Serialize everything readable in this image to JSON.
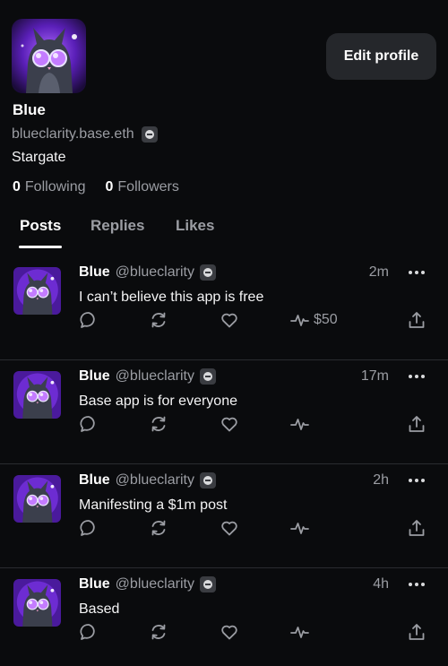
{
  "profile": {
    "display_name": "Blue",
    "handle": "blueclarity.base.eth",
    "bio": "Stargate",
    "following_count": "0",
    "following_label": "Following",
    "followers_count": "0",
    "followers_label": "Followers",
    "edit_label": "Edit profile"
  },
  "tabs": [
    {
      "label": "Posts",
      "active": true
    },
    {
      "label": "Replies",
      "active": false
    },
    {
      "label": "Likes",
      "active": false
    }
  ],
  "posts": [
    {
      "name": "Blue",
      "handle": "@blueclarity",
      "time": "2m",
      "text": "I can’t believe this app is free",
      "tip": "$50"
    },
    {
      "name": "Blue",
      "handle": "@blueclarity",
      "time": "17m",
      "text": "Base app is for everyone",
      "tip": ""
    },
    {
      "name": "Blue",
      "handle": "@blueclarity",
      "time": "2h",
      "text": "Manifesting a $1m post",
      "tip": ""
    },
    {
      "name": "Blue",
      "handle": "@blueclarity",
      "time": "4h",
      "text": "Based",
      "tip": ""
    }
  ],
  "icons": {
    "reply": "speech-bubble-icon",
    "recast": "repeat-icon",
    "like": "heart-icon",
    "tip": "pulse-icon",
    "share": "share-upload-icon",
    "more": "more-dots-icon",
    "verified": "verified-badge-icon"
  },
  "colors": {
    "background": "#0a0b0d",
    "button": "#25272b",
    "muted_text": "#9b9da3",
    "accent_purple": "#8b3cff"
  }
}
